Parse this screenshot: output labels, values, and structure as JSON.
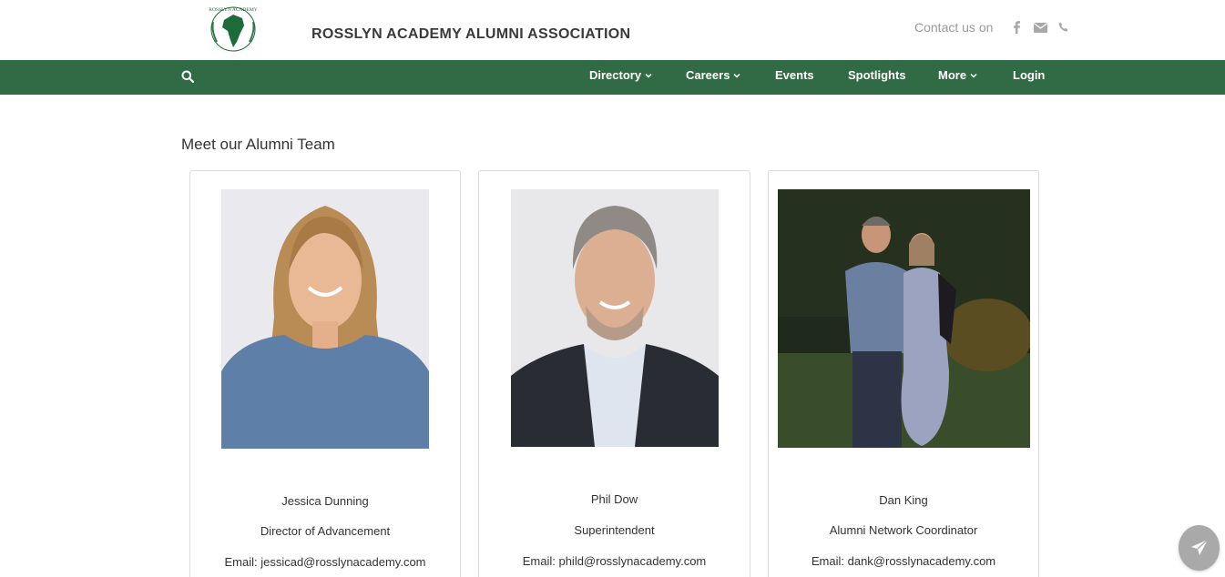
{
  "header": {
    "site_title": "ROSSLYN ACADEMY ALUMNI ASSOCIATION",
    "contact_label": "Contact us on",
    "contact_icons": [
      "facebook-icon",
      "envelope-icon",
      "phone-icon"
    ],
    "logo_text": "ROSSLYN ACADEMY"
  },
  "nav": {
    "items": [
      {
        "label": "Directory",
        "dropdown": true
      },
      {
        "label": "Careers",
        "dropdown": true
      },
      {
        "label": "Events",
        "dropdown": false
      },
      {
        "label": "Spotlights",
        "dropdown": false
      },
      {
        "label": "More",
        "dropdown": true
      },
      {
        "label": "Login",
        "dropdown": false
      }
    ]
  },
  "main": {
    "section_title": "Meet our Alumni Team",
    "team": [
      {
        "name": "Jessica Dunning",
        "role": "Director of Advancement",
        "email": "Email: jessicad@rosslynacademy.com"
      },
      {
        "name": "Phil Dow",
        "role": "Superintendent",
        "email": "Email: phild@rosslynacademy.com"
      },
      {
        "name": "Dan King",
        "role": "Alumni Network Coordinator",
        "email": "Email: dank@rosslynacademy.com"
      }
    ]
  },
  "colors": {
    "nav_green": "#316b45",
    "logo_green": "#1e6b3a",
    "fab_gray": "#a9a9a9"
  },
  "fab": {
    "icon": "paper-plane-icon"
  }
}
